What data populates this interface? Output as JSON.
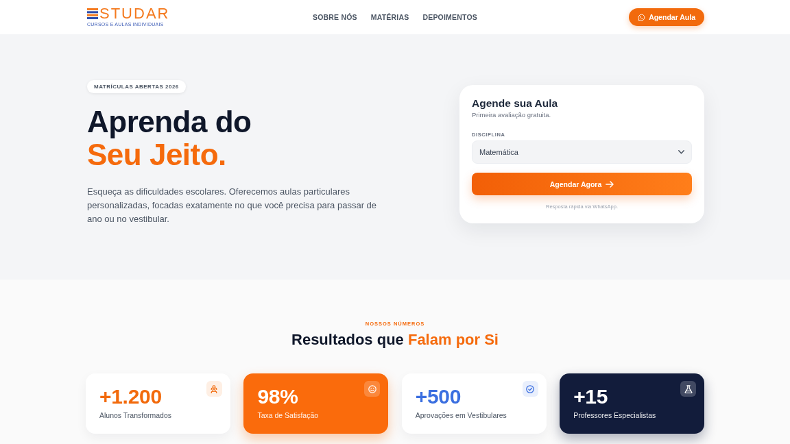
{
  "header": {
    "logo": {
      "wordmark": "STUDAR",
      "tagline": "CURSOS E AULAS INDIVIDUAIS"
    },
    "nav": [
      "SOBRE NÓS",
      "MATÉRIAS",
      "DEPOIMENTOS"
    ],
    "cta": "Agendar Aula"
  },
  "hero": {
    "badge": "MATRÍCULAS ABERTAS 2026",
    "headline": "Aprenda do",
    "headline_highlight": "Seu Jeito.",
    "text": "Esqueça as dificuldades escolares. Oferecemos aulas particulares personalizadas, focadas exatamente no que você precisa para passar de ano ou no vestibular.",
    "booking_form": {
      "title": "Agende sua Aula",
      "subtitle": "Primeira avaliação gratuita.",
      "field_label": "DISCIPLINA",
      "select_value": "Matemática",
      "submit": "Agendar Agora",
      "note": "Resposta rápida via WhatsApp."
    }
  },
  "stats": {
    "eyebrow": "NOSSOS NÚMEROS",
    "title": "Resultados que",
    "title_highlight": "Falam por Si",
    "cards": [
      {
        "kind": "plain",
        "color": "#f26a0c",
        "value": "+1.200",
        "label": "Alunos Transformados"
      },
      {
        "kind": "filled",
        "color": "#fa6b0c",
        "value": "98%",
        "label": "Taxa de Satisfação"
      },
      {
        "kind": "plain",
        "color": "#3b6fe0",
        "value": "+500",
        "label": "Aprovações em Vestibulares"
      },
      {
        "kind": "filled",
        "color": "#121c3b",
        "value": "+15",
        "label": "Professores Especialistas"
      }
    ]
  }
}
